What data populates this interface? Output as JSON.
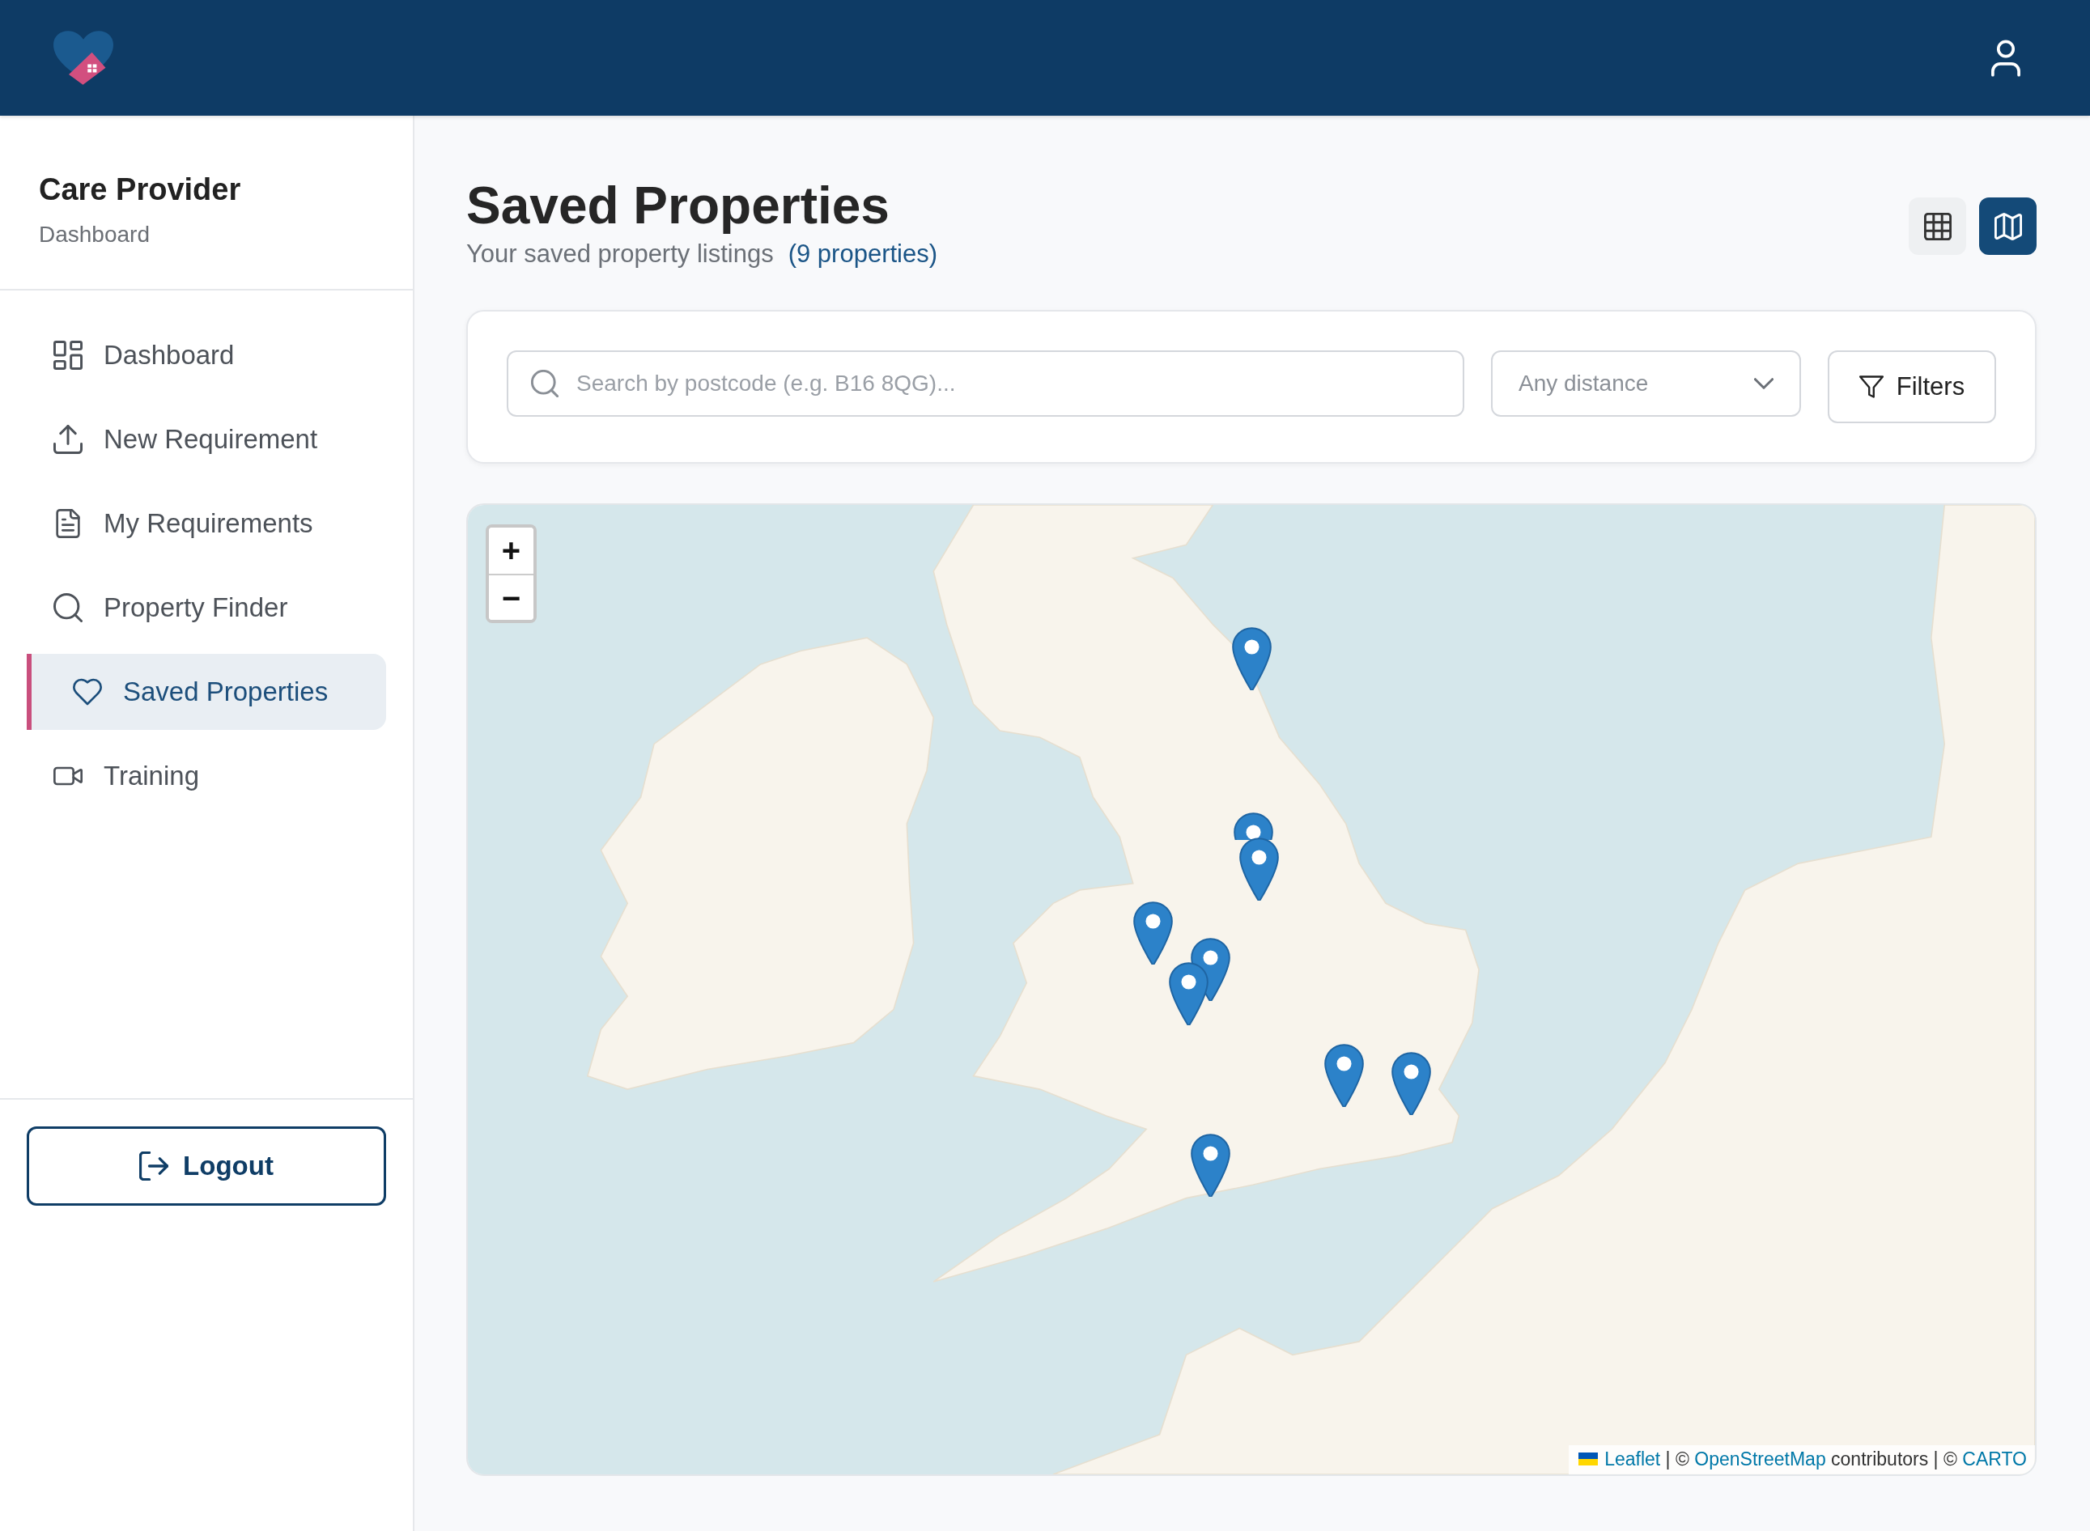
{
  "sidebar": {
    "title": "Care Provider",
    "subtitle": "Dashboard",
    "items": [
      {
        "label": "Dashboard",
        "selected": false
      },
      {
        "label": "New Requirement",
        "selected": false
      },
      {
        "label": "My Requirements",
        "selected": false
      },
      {
        "label": "Property Finder",
        "selected": false
      },
      {
        "label": "Saved Properties",
        "selected": true
      },
      {
        "label": "Training",
        "selected": false
      }
    ],
    "logout": "Logout"
  },
  "page": {
    "title": "Saved Properties",
    "subtitle": "Your saved property listings",
    "count": "(9 properties)"
  },
  "view_toggle": [
    {
      "kind": "grid",
      "selected": false
    },
    {
      "kind": "map",
      "selected": true
    }
  ],
  "filters": {
    "search": {
      "placeholder": "Search by postcode (e.g. B16 8QG)..."
    },
    "distance": {
      "value": "Any distance"
    },
    "button": "Filters"
  },
  "map": {
    "zoom_in": "+",
    "zoom_out": "−",
    "attribution": [
      {
        "kind": "link",
        "text": "Leaflet"
      },
      {
        "kind": "text",
        "text": "| ©"
      },
      {
        "kind": "link",
        "text": "OpenStreetMap"
      },
      {
        "kind": "text",
        "text": "contributors | ©"
      },
      {
        "kind": "link",
        "text": "CARTO"
      }
    ]
  }
}
